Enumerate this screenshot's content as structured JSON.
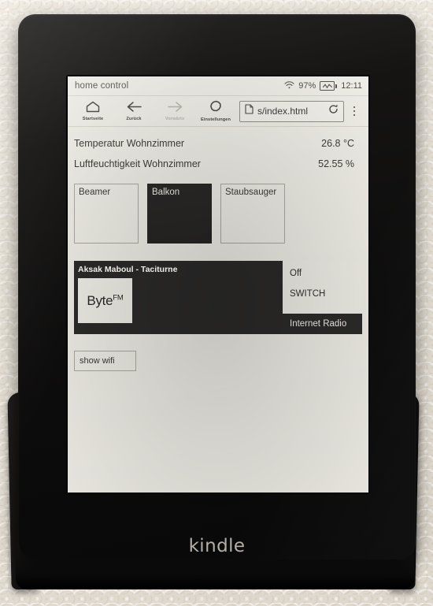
{
  "device": {
    "brand_label": "kindle"
  },
  "status_bar": {
    "title": "home control",
    "battery_percent": "97%",
    "time": "12:11",
    "wifi_icon": "wifi-icon",
    "battery_icon": "battery-charging-icon"
  },
  "toolbar": {
    "buttons": [
      {
        "label": "Startseite",
        "icon": "home-icon",
        "disabled": false
      },
      {
        "label": "Zurück",
        "icon": "arrow-left-icon",
        "disabled": false
      },
      {
        "label": "Vorwärts",
        "icon": "arrow-right-icon",
        "disabled": true
      },
      {
        "label": "Einstellungen",
        "icon": "gear-icon",
        "disabled": false
      }
    ],
    "url": "s/index.html",
    "page_icon": "page-icon",
    "reload_icon": "reload-icon",
    "menu_icon": "kebab-menu-icon"
  },
  "page": {
    "sensors": [
      {
        "name": "Temperatur Wohnzimmer",
        "value": "26.8 °C"
      },
      {
        "name": "Luftfeuchtigkeit Wohnzimmer",
        "value": "52.55 %"
      }
    ],
    "tiles": [
      {
        "label": "Beamer",
        "state": "off"
      },
      {
        "label": "Balkon",
        "state": "on"
      },
      {
        "label": "Staubsauger",
        "state": "off"
      }
    ],
    "radio": {
      "now_playing": "Aksak Maboul - Taciturne",
      "ghost_text": "",
      "station_name": "Byte",
      "station_suffix": "FM",
      "menu": [
        {
          "label": "Off",
          "selected": false
        },
        {
          "label": "SWITCH",
          "selected": false
        },
        {
          "label": "Internet Radio",
          "selected": true
        }
      ]
    },
    "wifi_button": "show wifi"
  },
  "colors": {
    "screen_bg": "#eceae3",
    "ink": "#3a3835",
    "active_tile": "#262524",
    "panel_dark": "#2b2a29"
  }
}
